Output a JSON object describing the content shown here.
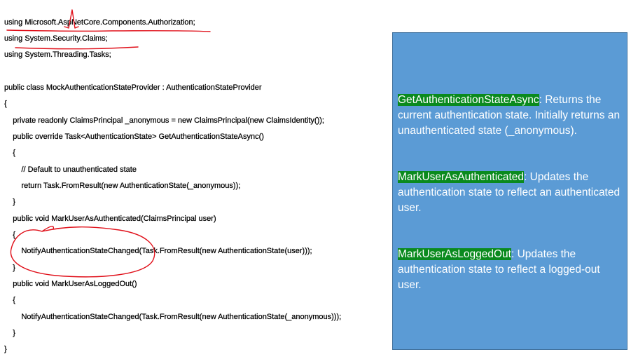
{
  "code": {
    "lines": [
      "using Microsoft.AspNetCore.Components.Authorization;",
      "using System.Security.Claims;",
      "using System.Threading.Tasks;",
      "",
      "public class MockAuthenticationStateProvider : AuthenticationStateProvider",
      "{",
      "    private readonly ClaimsPrincipal _anonymous = new ClaimsPrincipal(new ClaimsIdentity());",
      "    public override Task<AuthenticationState> GetAuthenticationStateAsync()",
      "    {",
      "        // Default to unauthenticated state",
      "        return Task.FromResult(new AuthenticationState(_anonymous));",
      "    }",
      "    public void MarkUserAsAuthenticated(ClaimsPrincipal user)",
      "    {",
      "        NotifyAuthenticationStateChanged(Task.FromResult(new AuthenticationState(user)));",
      "    }",
      "    public void MarkUserAsLoggedOut()",
      "    {",
      "        NotifyAuthenticationStateChanged(Task.FromResult(new AuthenticationState(_anonymous)));",
      "    }",
      "}"
    ]
  },
  "panel": {
    "notes": [
      {
        "method": "GetAuthenticationStateAsync",
        "text": ": Returns the current authentication state. Initially returns an unauthenticated state (_anonymous)."
      },
      {
        "method": "MarkUserAsAuthenticated",
        "text": ": Updates the authentication state to reflect an authenticated user."
      },
      {
        "method": "MarkUserAsLoggedOut",
        "text": ": Updates the authentication state to reflect a logged-out user."
      }
    ]
  },
  "colors": {
    "panel_bg": "#5b9bd5",
    "panel_border": "#41719c",
    "highlight": "#0a8a1e",
    "annotation_ink": "#e0101a"
  }
}
